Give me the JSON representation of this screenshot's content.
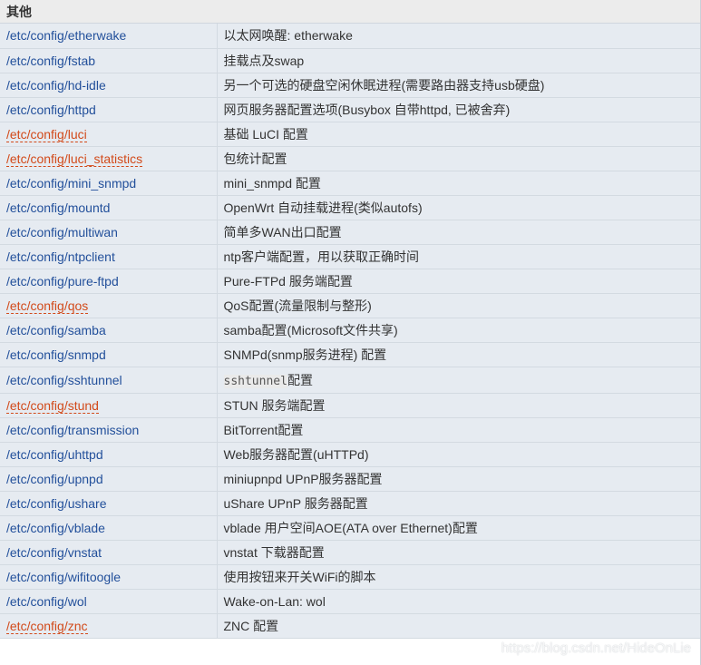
{
  "section": {
    "title": "其他"
  },
  "rows": [
    {
      "path": "/etc/config/etherwake",
      "desc": "以太网唤醒: etherwake",
      "special": false
    },
    {
      "path": "/etc/config/fstab",
      "desc": "挂载点及swap",
      "special": false
    },
    {
      "path": "/etc/config/hd-idle",
      "desc": "另一个可选的硬盘空闲休眠进程(需要路由器支持usb硬盘)",
      "special": false
    },
    {
      "path": "/etc/config/httpd",
      "desc": "网页服务器配置选项(Busybox 自带httpd, 已被舍弃)",
      "special": false
    },
    {
      "path": "/etc/config/luci",
      "desc": "基础 LuCI 配置",
      "special": true
    },
    {
      "path": "/etc/config/luci_statistics",
      "desc": "包统计配置",
      "special": true
    },
    {
      "path": "/etc/config/mini_snmpd",
      "desc": "mini_snmpd 配置",
      "special": false
    },
    {
      "path": "/etc/config/mountd",
      "desc": "OpenWrt 自动挂载进程(类似autofs)",
      "special": false
    },
    {
      "path": "/etc/config/multiwan",
      "desc": "简单多WAN出口配置",
      "special": false
    },
    {
      "path": "/etc/config/ntpclient",
      "desc": "ntp客户端配置，用以获取正确时间",
      "special": false
    },
    {
      "path": "/etc/config/pure-ftpd",
      "desc": "Pure-FTPd 服务端配置",
      "special": false
    },
    {
      "path": "/etc/config/qos",
      "desc": "QoS配置(流量限制与整形)",
      "special": true
    },
    {
      "path": "/etc/config/samba",
      "desc": "samba配置(Microsoft文件共享)",
      "special": false
    },
    {
      "path": "/etc/config/snmpd",
      "desc": "SNMPd(snmp服务进程) 配置",
      "special": false
    },
    {
      "path": "/etc/config/sshtunnel",
      "desc_code": "sshtunnel",
      "desc": "配置",
      "special": false
    },
    {
      "path": "/etc/config/stund",
      "desc": "STUN 服务端配置",
      "special": true
    },
    {
      "path": "/etc/config/transmission",
      "desc": "BitTorrent配置",
      "special": false
    },
    {
      "path": "/etc/config/uhttpd",
      "desc": "Web服务器配置(uHTTPd)",
      "special": false
    },
    {
      "path": "/etc/config/upnpd",
      "desc": "miniupnpd UPnP服务器配置",
      "special": false
    },
    {
      "path": "/etc/config/ushare",
      "desc": "uShare UPnP 服务器配置",
      "special": false
    },
    {
      "path": "/etc/config/vblade",
      "desc": "vblade 用户空间AOE(ATA over Ethernet)配置",
      "special": false
    },
    {
      "path": "/etc/config/vnstat",
      "desc": "vnstat 下载器配置",
      "special": false
    },
    {
      "path": "/etc/config/wifitoogle",
      "desc": "使用按钮来开关WiFi的脚本",
      "special": false
    },
    {
      "path": "/etc/config/wol",
      "desc": "Wake-on-Lan: wol",
      "special": false
    },
    {
      "path": "/etc/config/znc",
      "desc": "ZNC 配置",
      "special": true
    }
  ],
  "watermark": "https://blog.csdn.net/HideOnLie"
}
